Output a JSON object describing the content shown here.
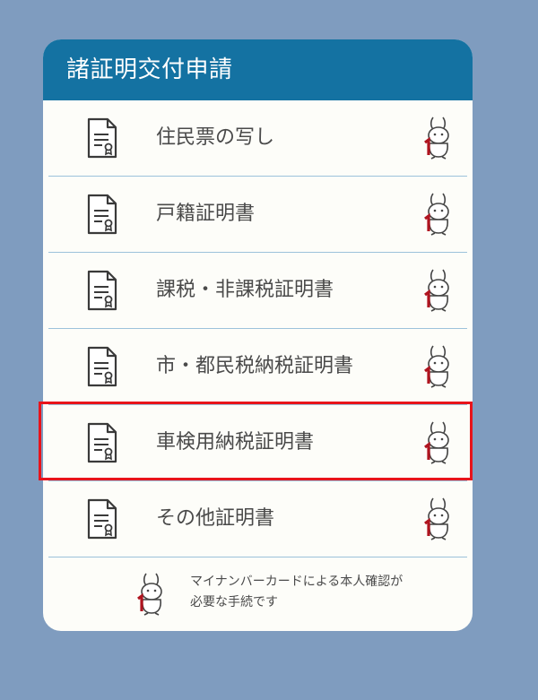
{
  "panel": {
    "title": "諸証明交付申請",
    "items": [
      {
        "label": "住民票の写し",
        "icon": "document-icon",
        "badge": "mynumber-card-icon"
      },
      {
        "label": "戸籍証明書",
        "icon": "document-icon",
        "badge": "mynumber-card-icon"
      },
      {
        "label": "課税・非課税証明書",
        "icon": "document-icon",
        "badge": "mynumber-card-icon"
      },
      {
        "label": "市・都民税納税証明書",
        "icon": "document-icon",
        "badge": "mynumber-card-icon"
      },
      {
        "label": "車検用納税証明書",
        "icon": "document-icon",
        "badge": "mynumber-card-icon"
      },
      {
        "label": "その他証明書",
        "icon": "document-icon",
        "badge": "mynumber-card-icon"
      }
    ],
    "note": {
      "line1": "マイナンバーカードによる本人確認が",
      "line2": "必要な手続です"
    }
  },
  "colors": {
    "background": "#7f9cbf",
    "header": "#1472a2",
    "card": "#fdfdf9",
    "divider": "#9cc2db",
    "highlight": "#e8141b",
    "badge_accent": "#b0141f"
  }
}
